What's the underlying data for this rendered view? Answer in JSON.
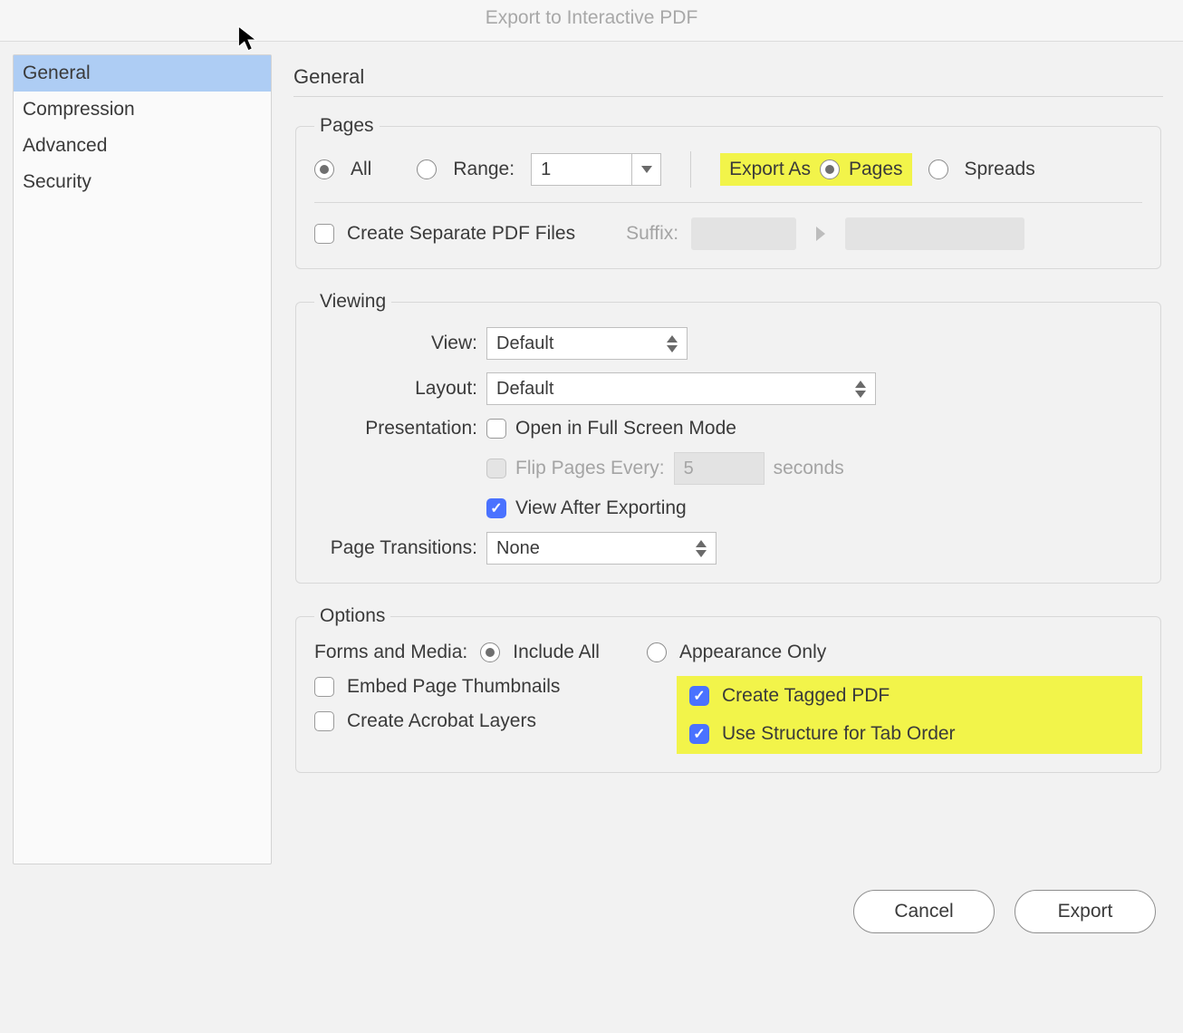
{
  "title": "Export to Interactive PDF",
  "sidebar": {
    "items": [
      "General",
      "Compression",
      "Advanced",
      "Security"
    ],
    "active": "General"
  },
  "section_title": "General",
  "pages": {
    "legend": "Pages",
    "all_label": "All",
    "range_label": "Range:",
    "range_value": "1",
    "export_as_label": "Export As",
    "pages_label": "Pages",
    "spreads_label": "Spreads",
    "create_separate_label": "Create Separate PDF Files",
    "suffix_label": "Suffix:"
  },
  "viewing": {
    "legend": "Viewing",
    "view_label": "View:",
    "view_value": "Default",
    "layout_label": "Layout:",
    "layout_value": "Default",
    "presentation_label": "Presentation:",
    "fullscreen_label": "Open in Full Screen Mode",
    "flip_label": "Flip Pages Every:",
    "flip_value": "5",
    "seconds_label": "seconds",
    "view_after_label": "View After Exporting",
    "transitions_label": "Page Transitions:",
    "transitions_value": "None"
  },
  "options": {
    "legend": "Options",
    "forms_media_label": "Forms and Media:",
    "include_all_label": "Include All",
    "appearance_only_label": "Appearance Only",
    "embed_thumbs_label": "Embed Page Thumbnails",
    "acrobat_layers_label": "Create Acrobat Layers",
    "tagged_pdf_label": "Create Tagged PDF",
    "tab_order_label": "Use Structure for Tab Order"
  },
  "buttons": {
    "cancel": "Cancel",
    "export": "Export"
  }
}
